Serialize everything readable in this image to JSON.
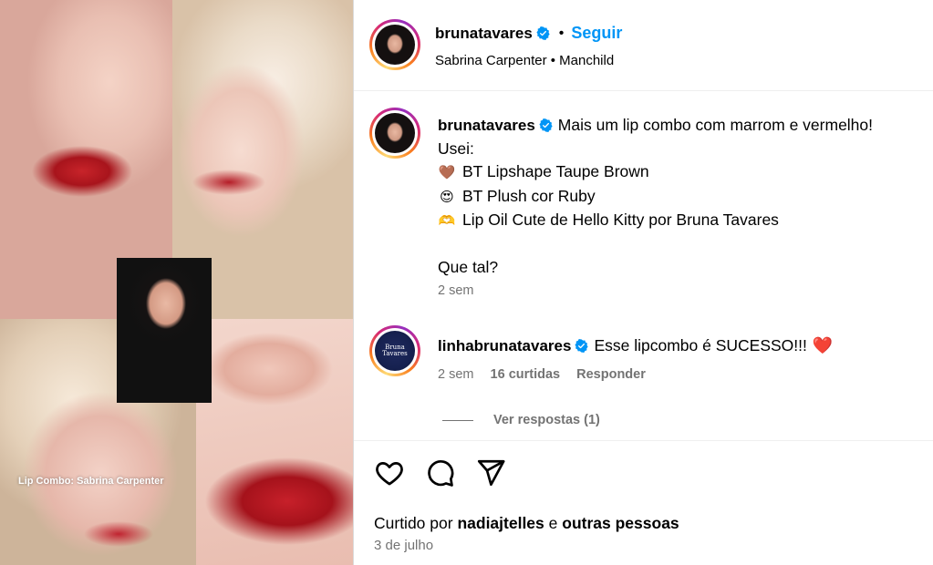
{
  "media": {
    "caption": "Lip Combo: Sabrina Carpenter"
  },
  "post": {
    "author": "brunatavares",
    "follow_label": "Seguir",
    "separator": "•",
    "audio": "Sabrina Carpenter • Manchild",
    "caption": {
      "username": "brunatavares",
      "first_line": "Mais um lip combo com marrom e vermelho!",
      "line2": "Usei:",
      "items": [
        {
          "emoji": "🤎",
          "text": "BT Lipshape Taupe Brown"
        },
        {
          "emoji": "😍",
          "text": "BT Plush cor Ruby"
        },
        {
          "emoji": "🫶",
          "text": "Lip Oil Cute de Hello Kitty por Bruna Tavares"
        }
      ],
      "closing": "Que tal?",
      "time": "2 sem"
    },
    "comments": [
      {
        "username": "linhabrunatavares",
        "text": "Esse lipcombo é SUCESSO!!!",
        "emoji": "❤️",
        "avatar_text": "Bruna Tavares",
        "time": "2 sem",
        "likes": "16 curtidas",
        "reply_label": "Responder",
        "view_replies": "Ver respostas (1)"
      }
    ],
    "liked_by": {
      "prefix": "Curtido por",
      "user": "nadiajtelles",
      "connector": "e",
      "others": "outras pessoas"
    },
    "date": "3 de julho"
  },
  "colors": {
    "accent": "#0095f6",
    "secondary_text": "#737373",
    "heart": "#ed2a5a"
  },
  "icons": [
    "verified-badge-icon",
    "like-heart-icon",
    "comment-icon",
    "share-icon"
  ]
}
